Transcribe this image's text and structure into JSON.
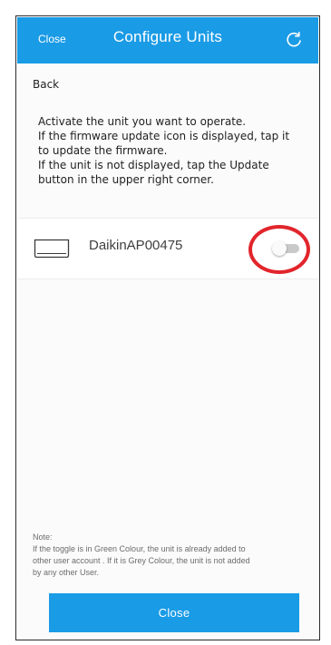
{
  "header": {
    "left_label": "Close",
    "title": "Configure Units",
    "refresh_icon": "refresh-icon"
  },
  "back_label": "Back",
  "instructions": [
    "Activate the unit you want to operate.",
    "If the firmware update icon is displayed, tap it",
    "to update the firmware.",
    "If the unit is not displayed, tap the Update",
    "button in the upper right corner."
  ],
  "unit": {
    "icon": "air-conditioner-icon",
    "name": "DaikinAP00475",
    "toggle_on": false
  },
  "note": {
    "heading": "Note:",
    "lines": [
      "If the toggle is in Green Colour, the unit is already added to",
      "other user account . If it is Grey Colour, the unit is not added",
      "by any other User."
    ]
  },
  "close_button_label": "Close",
  "colors": {
    "header_bg": "#1a9be6",
    "button_bg": "#1a9be6",
    "highlight": "#e2252c",
    "toggle_off": "#c9c9c9"
  }
}
